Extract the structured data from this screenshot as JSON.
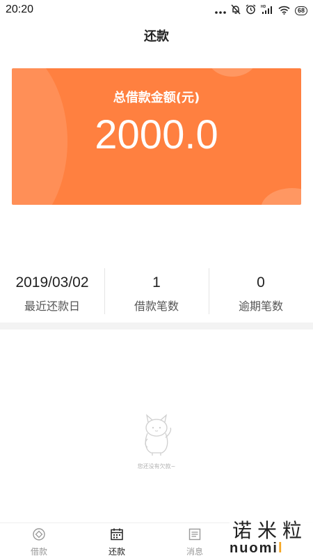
{
  "status_bar": {
    "time": "20:20",
    "battery": "68",
    "icons": [
      "more-dots-icon",
      "mute-icon",
      "alarm-icon",
      "hd-signal-icon",
      "wifi-icon",
      "battery-icon"
    ]
  },
  "header": {
    "title": "还款"
  },
  "summary_card": {
    "label": "总借款金额(元)",
    "amount": "2000.0",
    "background_color": "#ff8040"
  },
  "stats": [
    {
      "value": "2019/03/02",
      "label": "最近还款日"
    },
    {
      "value": "1",
      "label": "借款笔数"
    },
    {
      "value": "0",
      "label": "逾期笔数"
    }
  ],
  "empty_state": {
    "text": "您还没有欠款~",
    "icon": "cat-mascot-icon"
  },
  "tab_bar": {
    "active_index": 1,
    "items": [
      {
        "label": "借款",
        "icon": "coin-icon"
      },
      {
        "label": "还款",
        "icon": "calendar-icon"
      },
      {
        "label": "消息",
        "icon": "message-list-icon"
      },
      {
        "label": "",
        "icon": ""
      }
    ]
  },
  "watermark": {
    "chinese": "诺米粒",
    "latin_main": "nuomi",
    "latin_accent": "l"
  }
}
